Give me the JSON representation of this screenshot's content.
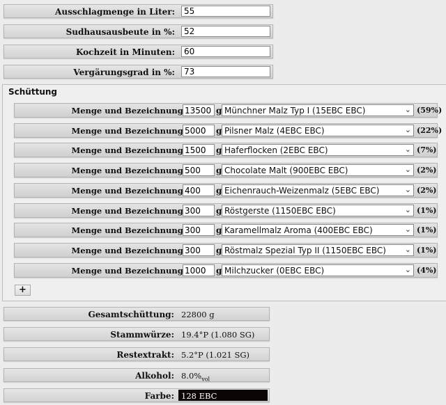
{
  "params": [
    {
      "label": "Ausschlagmenge in Liter:",
      "value": "55"
    },
    {
      "label": "Sudhausausbeute in %:",
      "value": "52"
    },
    {
      "label": "Kochzeit in Minuten:",
      "value": "60"
    },
    {
      "label": "Vergärungsgrad in %:",
      "value": "73"
    }
  ],
  "schuettung": {
    "legend": "Schüttung",
    "row_label": "Menge und Bezeichnung:",
    "unit": "g",
    "add_label": "+",
    "items": [
      {
        "amount": "13500",
        "malt": "Münchner Malz Typ I (15EBC EBC)",
        "percent": "(59%)"
      },
      {
        "amount": "5000",
        "malt": "Pilsner Malz (4EBC EBC)",
        "percent": "(22%)"
      },
      {
        "amount": "1500",
        "malt": "Haferflocken (2EBC EBC)",
        "percent": "(7%)"
      },
      {
        "amount": "500",
        "malt": "Chocolate Malt (900EBC EBC)",
        "percent": "(2%)"
      },
      {
        "amount": "400",
        "malt": "Eichenrauch-Weizenmalz (5EBC EBC)",
        "percent": "(2%)"
      },
      {
        "amount": "300",
        "malt": "Röstgerste (1150EBC EBC)",
        "percent": "(1%)"
      },
      {
        "amount": "300",
        "malt": "Karamellmalz Aroma (400EBC EBC)",
        "percent": "(1%)"
      },
      {
        "amount": "300",
        "malt": "Röstmalz Spezial Typ II (1150EBC EBC)",
        "percent": "(1%)"
      },
      {
        "amount": "1000",
        "malt": "Milchzucker (0EBC EBC)",
        "percent": "(4%)"
      }
    ]
  },
  "results": {
    "gesamt": {
      "label": "Gesamtschüttung:",
      "value": "22800 g"
    },
    "stammwuerze": {
      "label": "Stammwürze:",
      "value": "19.4°P (1.080 SG)"
    },
    "restextrakt": {
      "label": "Restextrakt:",
      "value": "5.2°P (1.021 SG)"
    },
    "alkohol": {
      "label": "Alkohol:",
      "value": "8.0%",
      "sub": "vol"
    },
    "farbe": {
      "label": "Farbe:",
      "value": "128 EBC",
      "color": "#0b0505"
    }
  },
  "icons": {
    "dropdown": "chevron-down-icon",
    "add": "plus-icon"
  }
}
